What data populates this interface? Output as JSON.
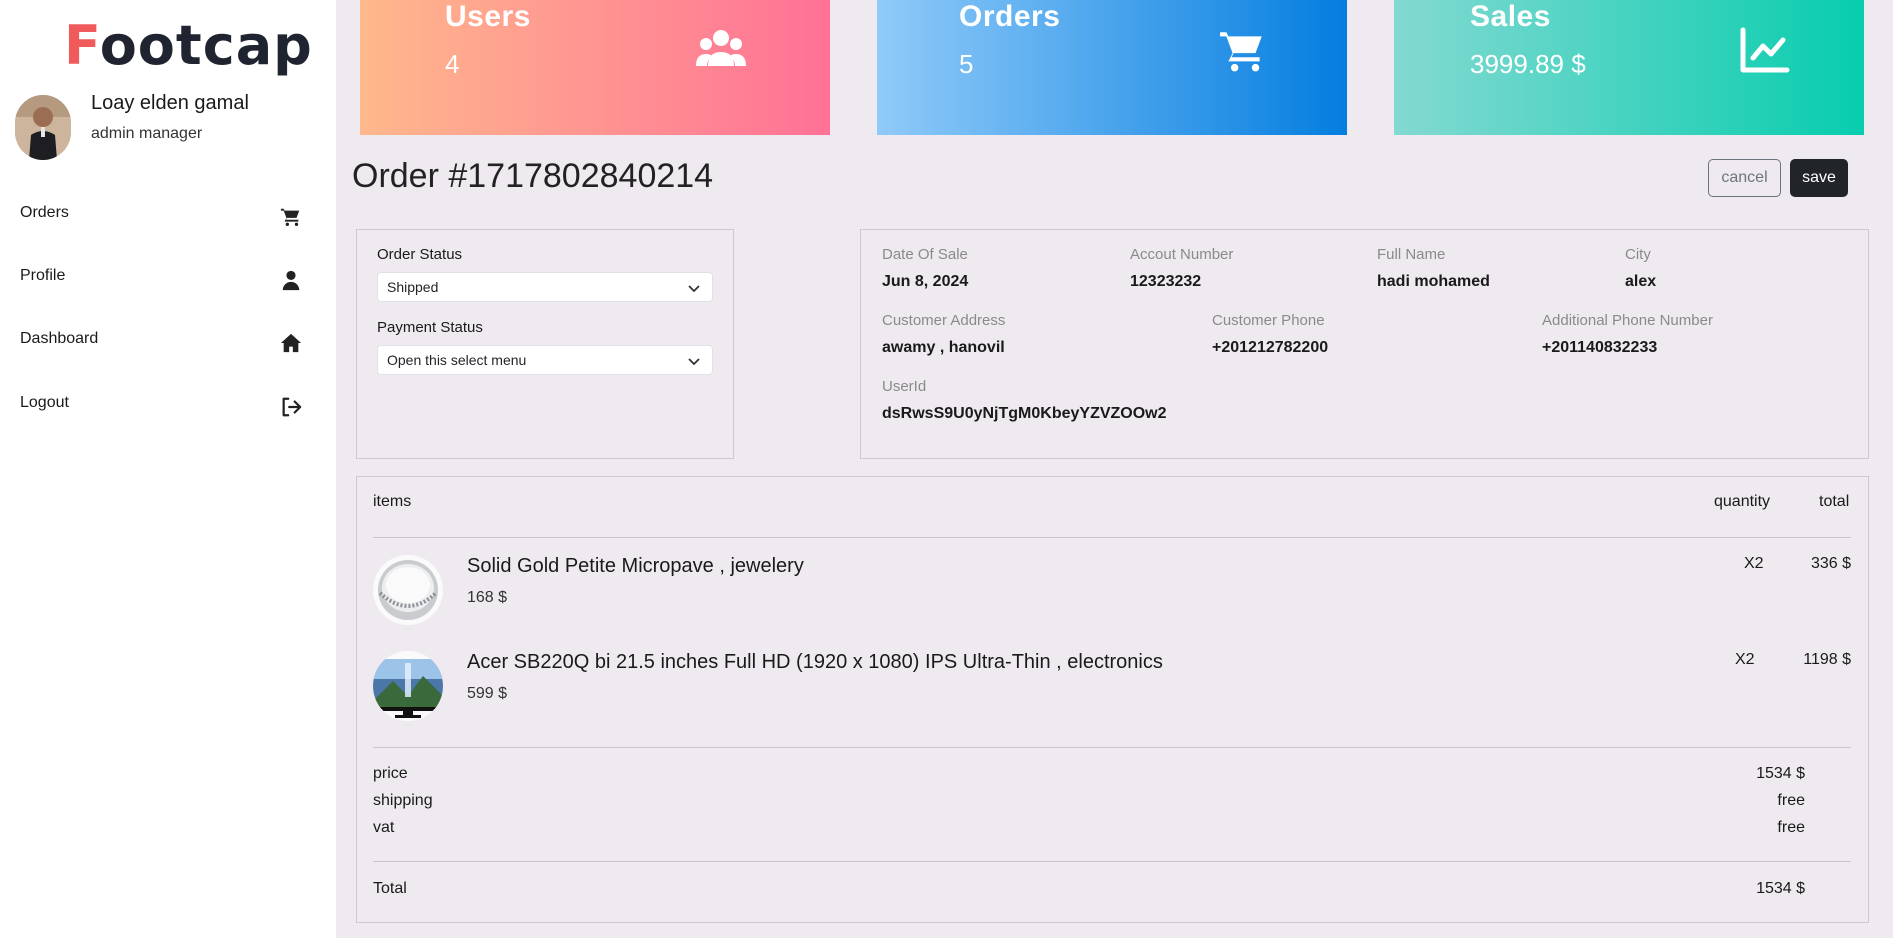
{
  "sidebar": {
    "logo_first": "F",
    "logo_rest": "ootcap",
    "user_name": "Loay elden gamal",
    "user_role": "admin manager",
    "nav": [
      {
        "label": "Orders",
        "icon": "cart-icon"
      },
      {
        "label": "Profile",
        "icon": "user-icon"
      },
      {
        "label": "Dashboard",
        "icon": "home-icon"
      },
      {
        "label": "Logout",
        "icon": "logout-icon"
      }
    ]
  },
  "stats": {
    "users": {
      "title": "Users",
      "value": "4",
      "icon": "users-icon"
    },
    "orders": {
      "title": "Orders",
      "value": "5",
      "icon": "cart-icon"
    },
    "sales": {
      "title": "Sales",
      "value": "3999.89 $",
      "icon": "chart-line-icon"
    }
  },
  "order": {
    "title": "Order #1717802840214",
    "cancel_label": "cancel",
    "save_label": "save"
  },
  "status": {
    "order_status_label": "Order Status",
    "order_status_value": "Shipped",
    "payment_status_label": "Payment Status",
    "payment_status_value": "Open this select menu"
  },
  "info": {
    "date_label": "Date Of Sale",
    "date_value": "Jun 8, 2024",
    "account_label": "Accout Number",
    "account_value": "12323232",
    "fullname_label": "Full Name",
    "fullname_value": "hadi mohamed",
    "city_label": "City",
    "city_value": "alex",
    "address_label": "Customer Address",
    "address_value": "awamy , hanovil",
    "phone_label": "Customer Phone",
    "phone_value": "+201212782200",
    "addphone_label": "Additional Phone Number",
    "addphone_value": "+201140832233",
    "userid_label": "UserId",
    "userid_value": "dsRwsS9U0yNjTgM0KbeyYZVZOOw2"
  },
  "items": {
    "head_items": "items",
    "head_quantity": "quantity",
    "head_total": "total",
    "list": [
      {
        "name": "Solid Gold Petite Micropave , jewelery",
        "price": "168 $",
        "qty": "X2",
        "total": "336 $"
      },
      {
        "name": "Acer SB220Q bi 21.5 inches Full HD (1920 x 1080) IPS Ultra-Thin , electronics",
        "price": "599 $",
        "qty": "X2",
        "total": "1198 $"
      }
    ]
  },
  "summary": {
    "price_label": "price",
    "price_value": "1534 $",
    "shipping_label": "shipping",
    "shipping_value": "free",
    "vat_label": "vat",
    "vat_value": "free",
    "total_label": "Total",
    "total_value": "1534 $"
  }
}
